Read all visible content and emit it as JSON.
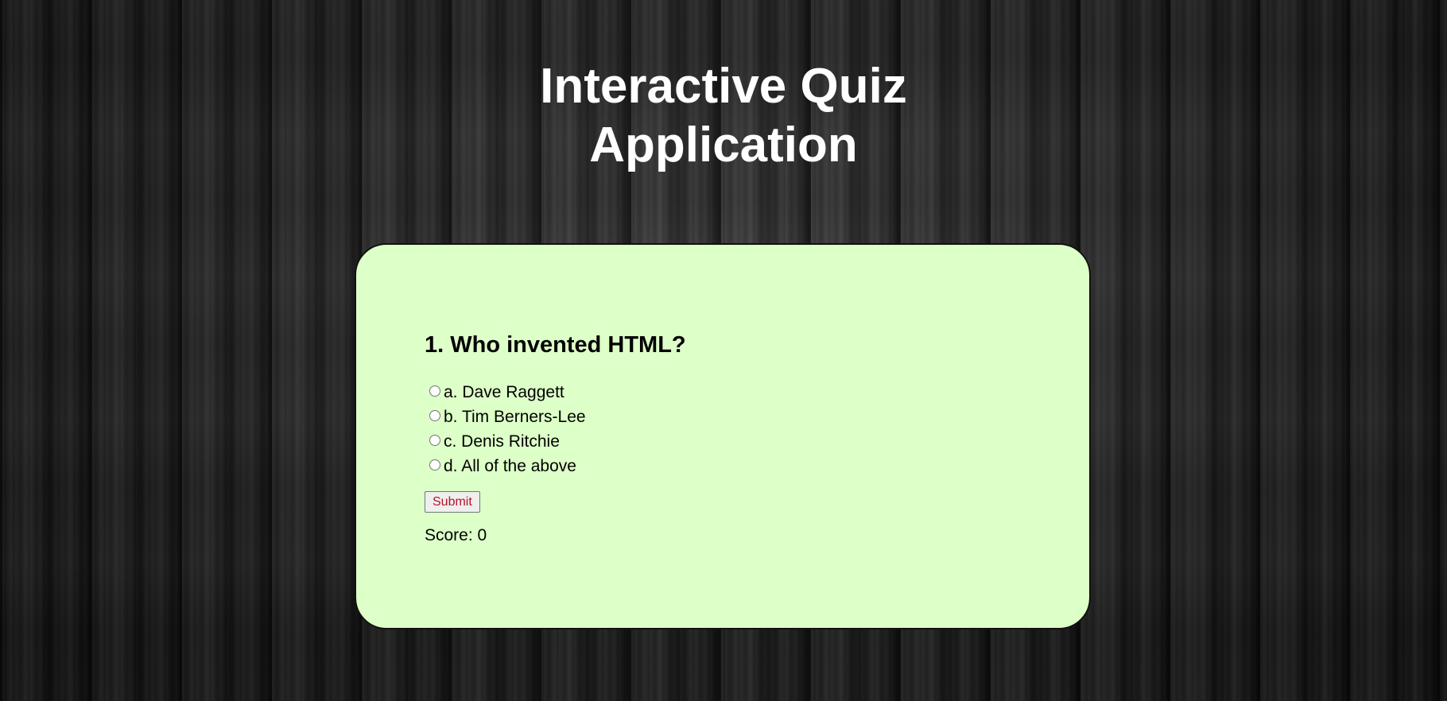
{
  "page": {
    "title_line1": "Interactive Quiz",
    "title_line2": "Application"
  },
  "quiz": {
    "question": "1. Who invented HTML?",
    "options": [
      "a. Dave Raggett",
      "b. Tim Berners-Lee",
      "c. Denis Ritchie",
      "d. All of the above"
    ],
    "submit_label": "Submit",
    "score_label": "Score: 0"
  },
  "colors": {
    "card_background": "#ddffc8",
    "title_text": "#ffffff",
    "submit_text": "#b5152b"
  }
}
